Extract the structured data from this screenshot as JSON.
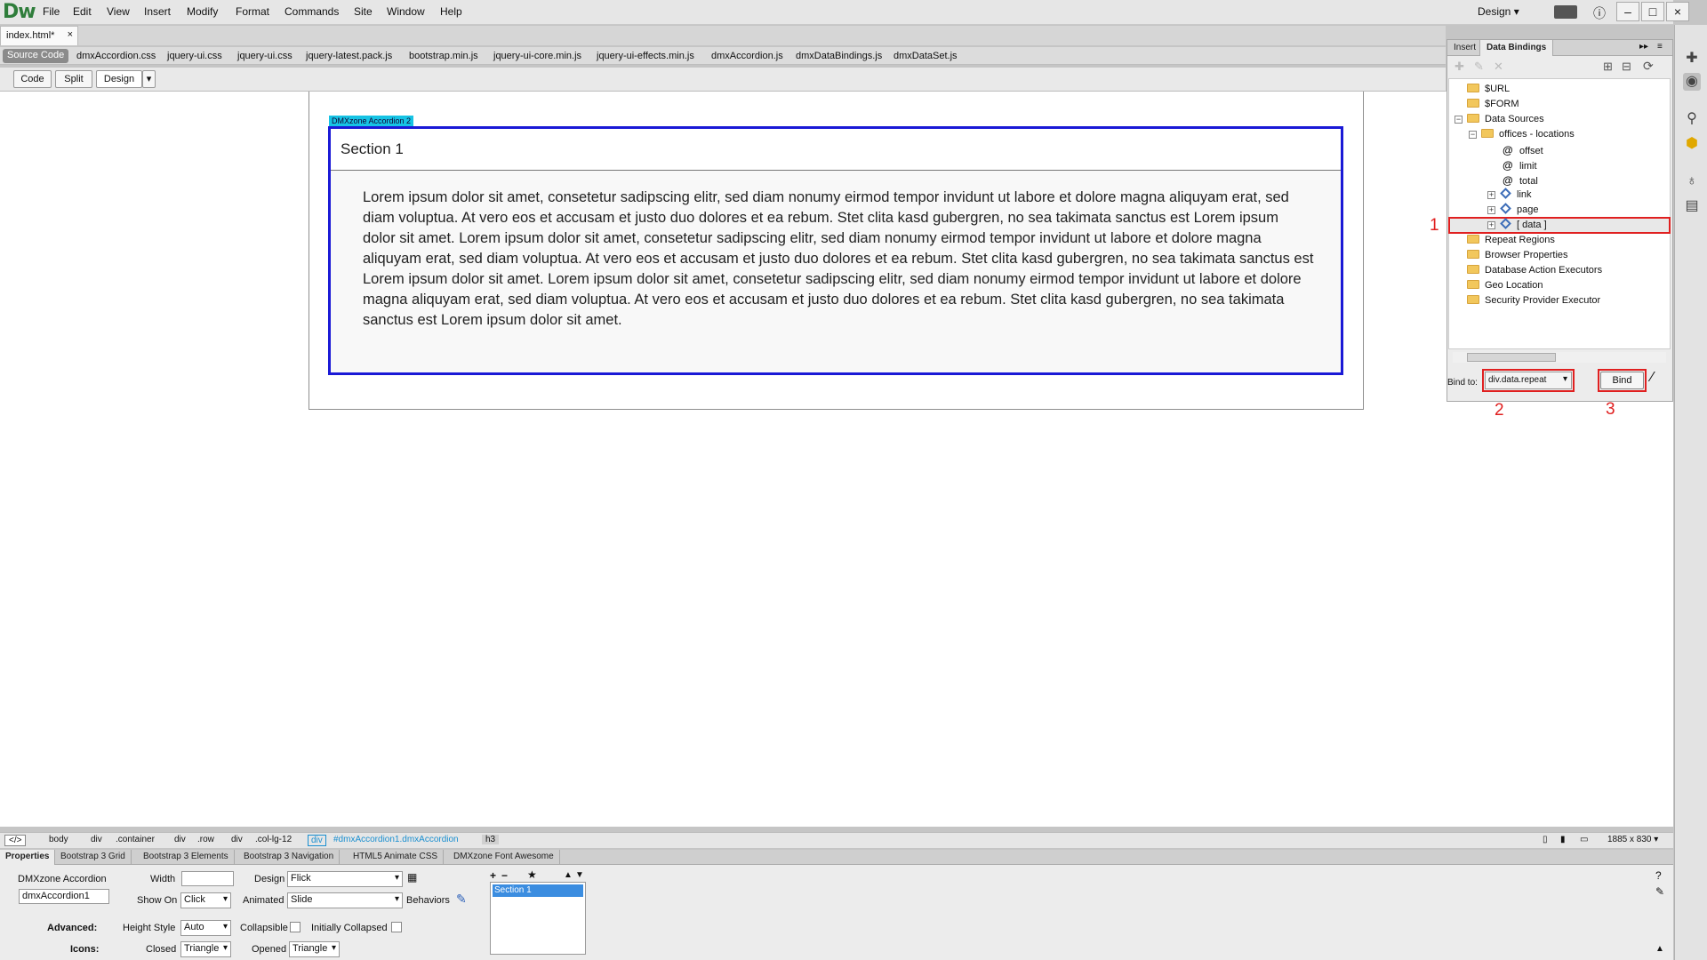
{
  "app": {
    "logo": "Dw",
    "workspace": "Design"
  },
  "menu": [
    "File",
    "Edit",
    "View",
    "Insert",
    "Modify",
    "Format",
    "Commands",
    "Site",
    "Window",
    "Help"
  ],
  "document": {
    "tab": "index.html*",
    "close": "×"
  },
  "related": {
    "source": "Source Code",
    "files": [
      "dmxAccordion.css",
      "jquery-ui.css",
      "jquery-ui.css",
      "jquery-latest.pack.js",
      "bootstrap.min.js",
      "jquery-ui-core.min.js",
      "jquery-ui-effects.min.js",
      "dmxAccordion.js",
      "dmxDataBindings.js",
      "dmxDataSet.js"
    ]
  },
  "views": {
    "code": "Code",
    "split": "Split",
    "design": "Design"
  },
  "accordion": {
    "label": "DMXzone Accordion 2",
    "section": "Section 1",
    "text": "Lorem ipsum dolor sit amet, consetetur sadipscing elitr, sed diam nonumy eirmod tempor invidunt ut labore et dolore magna aliquyam erat, sed diam voluptua. At vero eos et accusam et justo duo dolores et ea rebum. Stet clita kasd gubergren, no sea takimata sanctus est Lorem ipsum dolor sit amet. Lorem ipsum dolor sit amet, consetetur sadipscing elitr, sed diam nonumy eirmod tempor invidunt ut labore et dolore magna aliquyam erat, sed diam voluptua. At vero eos et accusam et justo duo dolores et ea rebum. Stet clita kasd gubergren, no sea takimata sanctus est Lorem ipsum dolor sit amet. Lorem ipsum dolor sit amet, consetetur sadipscing elitr, sed diam nonumy eirmod tempor invidunt ut labore et dolore magna aliquyam erat, sed diam voluptua. At vero eos et accusam et justo duo dolores et ea rebum. Stet clita kasd gubergren, no sea takimata sanctus est Lorem ipsum dolor sit amet."
  },
  "panel": {
    "tabs": {
      "insert": "Insert",
      "bindings": "Data Bindings"
    },
    "tree": {
      "url": "$URL",
      "form": "$FORM",
      "sources": "Data Sources",
      "offices": "offices - locations",
      "offset": "offset",
      "limit": "limit",
      "total": "total",
      "link": "link",
      "page": "page",
      "data": "[ data ]",
      "repeat": "Repeat Regions",
      "browser": "Browser Properties",
      "db": "Database Action Executors",
      "geo": "Geo Location",
      "security": "Security Provider Executor"
    },
    "bind_label": "Bind to:",
    "bind_value": "div.data.repeat",
    "bind_button": "Bind",
    "annotations": [
      "1",
      "2",
      "3"
    ]
  },
  "tagbar": {
    "code": "</>",
    "tags": [
      "body",
      "div",
      ".container",
      "div",
      ".row",
      "div",
      ".col-lg-12",
      "div",
      "#dmxAccordion1.dmxAccordion",
      "h3"
    ],
    "size": "1885 x 830 ▾"
  },
  "props": {
    "tabs": [
      "Properties",
      "Bootstrap 3 Grid",
      "Bootstrap 3 Elements",
      "Bootstrap 3 Navigation",
      "HTML5 Animate CSS",
      "DMXzone Font Awesome"
    ],
    "component": "DMXzone Accordion",
    "id": "dmxAccordion1",
    "width": "Width",
    "show_on": "Show On",
    "show_on_val": "Click",
    "design": "Design",
    "design_val": "Flick",
    "animated": "Animated",
    "animated_val": "Slide",
    "behaviors": "Behaviors",
    "advanced": "Advanced:",
    "height_style": "Height Style",
    "height_val": "Auto",
    "collapsible": "Collapsible",
    "initially": "Initially Collapsed",
    "icons": "Icons:",
    "closed": "Closed",
    "closed_val": "Triangle",
    "opened": "Opened",
    "opened_val": "Triangle",
    "section_item": "Section 1"
  }
}
